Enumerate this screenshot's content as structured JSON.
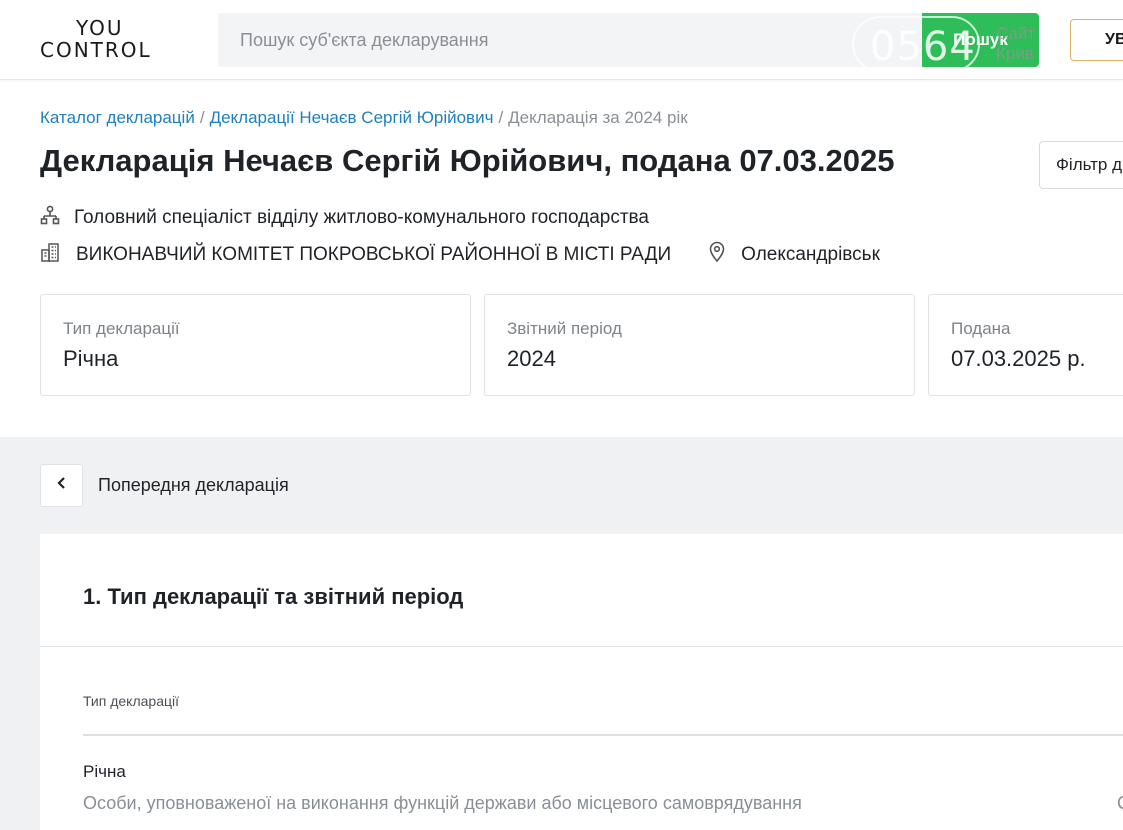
{
  "header": {
    "logo_line1": "YOU",
    "logo_line2": "CONTROL",
    "search_placeholder": "Пошук суб'єкта декларування",
    "search_button": "Пошук",
    "watermark_number": "0564",
    "watermark_text_line1": "Сайт",
    "watermark_text_line2": "Крив",
    "login_button": "УВ"
  },
  "breadcrumb": {
    "item1": "Каталог декларацій",
    "item2": "Декларації Нечаєв Сергій Юрійович",
    "current": "Декларація за 2024 рік",
    "separator": "/"
  },
  "page": {
    "title": "Декларація Нечаєв Сергій Юрійович, подана 07.03.2025",
    "filter_button": "Фільтр д",
    "position": "Головний спеціаліст відділу житлово-комунального господарства",
    "organization": "ВИКОНАВЧИЙ КОМІТЕТ ПОКРОВСЬКОЇ РАЙОННОЇ В МІСТІ РАДИ",
    "city": "Олександрівськ"
  },
  "cards": [
    {
      "label": "Тип декларації",
      "value": "Річна"
    },
    {
      "label": "Звітний період",
      "value": "2024"
    },
    {
      "label": "Подана",
      "value": "07.03.2025 р."
    }
  ],
  "navigation": {
    "prev_label": "Попередня декларація"
  },
  "section1": {
    "title": "1. Тип декларації та звітний період",
    "field_label": "Тип декларації",
    "field_value": "Річна",
    "field_sub": "Особи, уповноваженої на виконання функцій держави або місцевого самоврядування",
    "cut_char": "С"
  },
  "colors": {
    "accent_link": "#1f7fbf",
    "search_button": "#2ebd59",
    "login_border": "#d9b46a",
    "band_bg": "#f0f1f3"
  }
}
